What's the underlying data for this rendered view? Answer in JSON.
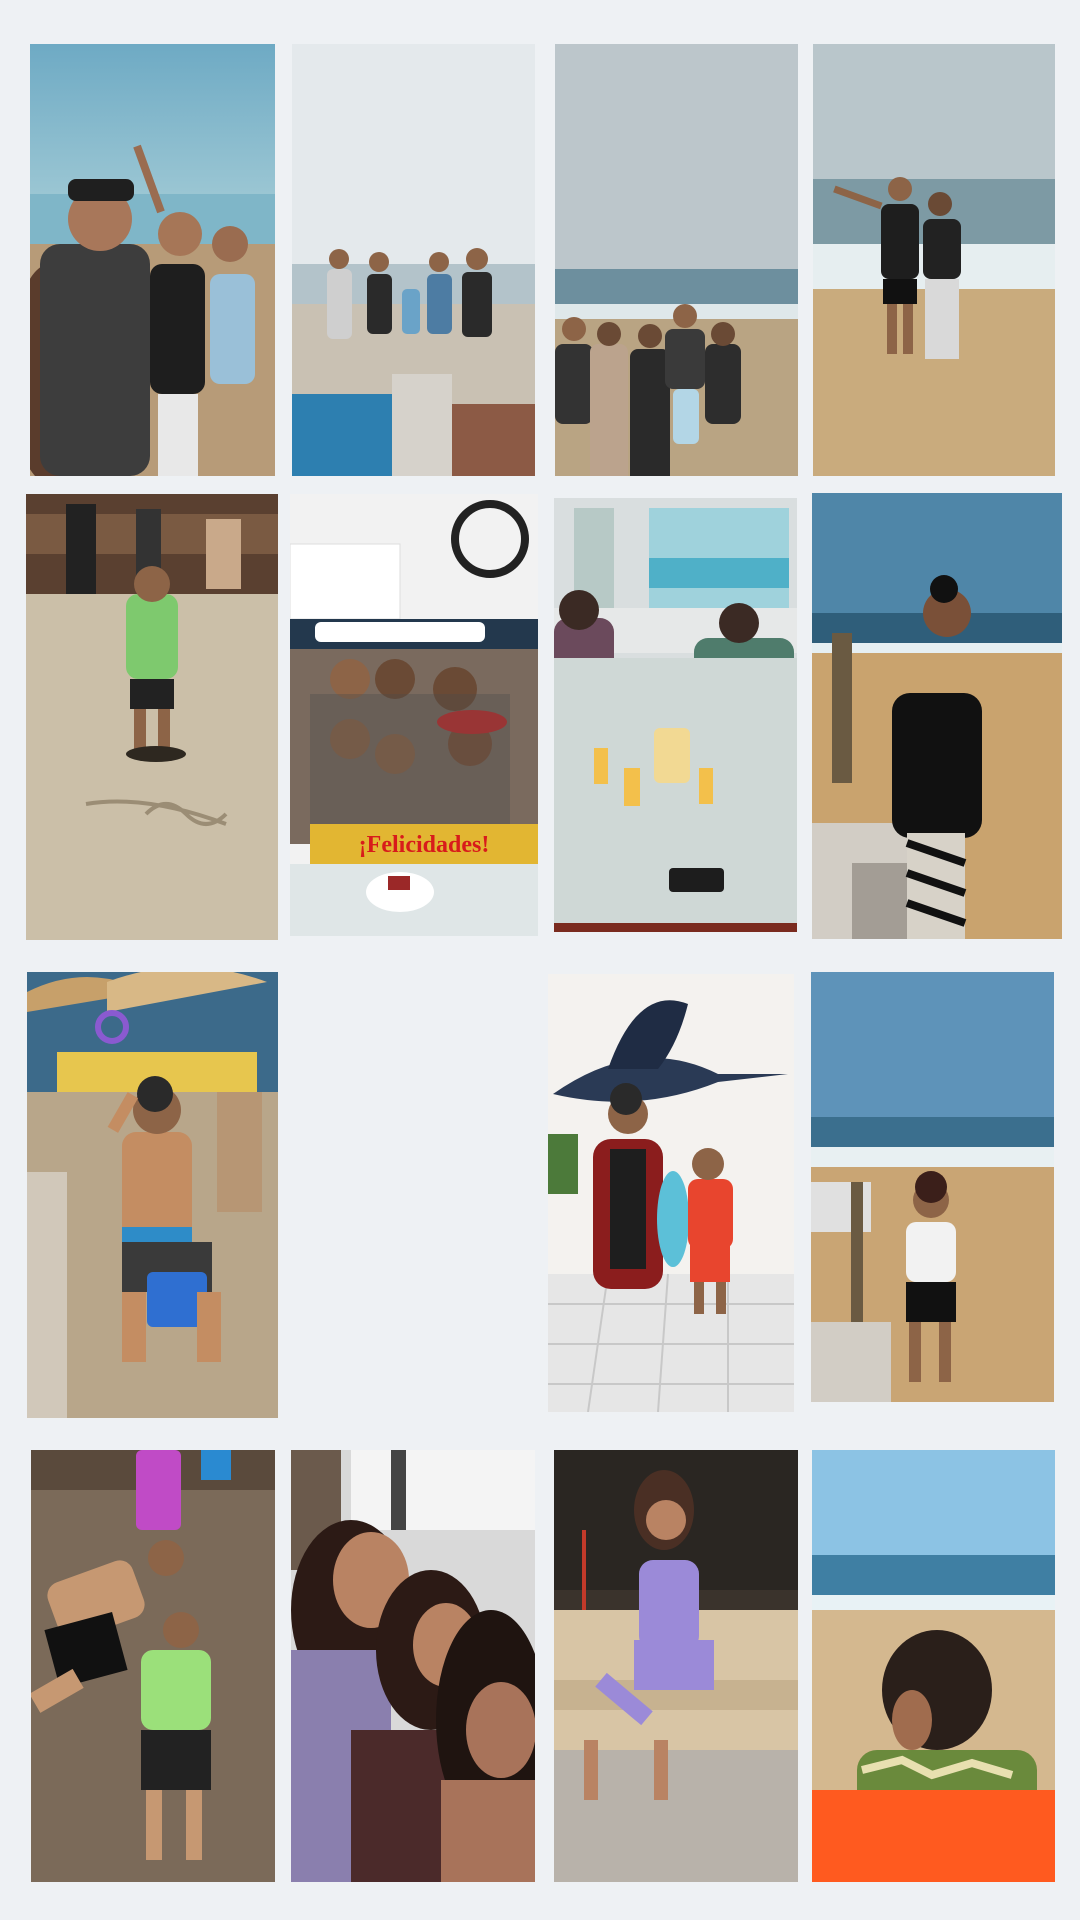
{
  "collage": {
    "background": "#eef1f4",
    "rows": 4,
    "columns": 4,
    "empty_cells": 1
  },
  "photos": [
    {
      "id": "r1c1",
      "scene": "beach-group-selfie",
      "palette": [
        "#7fb3c6",
        "#b79b78",
        "#2a2a2a"
      ]
    },
    {
      "id": "r1c2",
      "scene": "group-by-pool",
      "palette": [
        "#dfe5e8",
        "#c8c2b6",
        "#2d7fb0"
      ]
    },
    {
      "id": "r1c3",
      "scene": "family-on-beach",
      "palette": [
        "#b9c3c8",
        "#b9a483",
        "#2a2a2a"
      ]
    },
    {
      "id": "r1c4",
      "scene": "couple-on-beach",
      "palette": [
        "#b6c2c6",
        "#c9ab7d",
        "#1e1e1e"
      ]
    },
    {
      "id": "r2c1",
      "scene": "boy-on-sand-with-writing",
      "palette": [
        "#cbbfa8",
        "#7ec96e",
        "#3b3228"
      ]
    },
    {
      "id": "r2c2",
      "scene": "birthday-frame-group",
      "palette": [
        "#f2f2f2",
        "#e2b632",
        "#3a3a3a"
      ],
      "banner_text": "¡Felicidades!"
    },
    {
      "id": "r2c3",
      "scene": "restaurant-table",
      "palette": [
        "#9fd2dc",
        "#cfd8d6",
        "#f3c04b"
      ]
    },
    {
      "id": "r2c4",
      "scene": "woman-on-beach-steps",
      "palette": [
        "#4f86a8",
        "#c9a36e",
        "#111111"
      ]
    },
    {
      "id": "r3c1",
      "scene": "boy-on-cooler",
      "palette": [
        "#b8a68a",
        "#2f6fd1",
        "#c48d62"
      ]
    },
    {
      "id": "r3c3",
      "scene": "woman-and-boy-under-marlin",
      "palette": [
        "#f4f2ef",
        "#e8452e",
        "#8b1d1d"
      ]
    },
    {
      "id": "r3c4",
      "scene": "woman-on-beach-rail",
      "palette": [
        "#5e93b9",
        "#c9a574",
        "#111111"
      ]
    },
    {
      "id": "r4c1",
      "scene": "man-and-boy-lying-on-sand",
      "palette": [
        "#7b6a59",
        "#9be07a",
        "#111111"
      ]
    },
    {
      "id": "r4c2",
      "scene": "three-women-selfie",
      "palette": [
        "#d9d9d9",
        "#b98363",
        "#4b2a2a"
      ]
    },
    {
      "id": "r4c3",
      "scene": "woman-sitting-at-night",
      "palette": [
        "#2a2622",
        "#d8c5a5",
        "#9b8ad8"
      ]
    },
    {
      "id": "r4c4",
      "scene": "boy-with-towel-at-sea",
      "palette": [
        "#8cc3e4",
        "#d4b88f",
        "#ff5a1f"
      ]
    }
  ]
}
